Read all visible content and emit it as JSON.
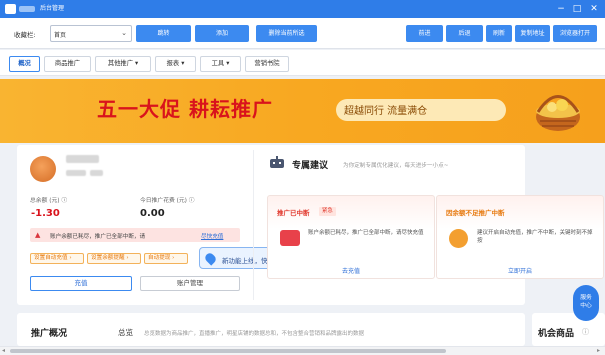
{
  "window": {
    "title": "后台管理",
    "controls": [
      "−",
      "□",
      "✕"
    ]
  },
  "toolbar": {
    "fav_label": "收藏栏:",
    "fav_value": "首页",
    "buttons": {
      "jump": "跳转",
      "add": "添加",
      "delete_selected": "删除当前所选",
      "back": "前进",
      "forward": "后退",
      "refresh": "刷新",
      "copy_url": "复制地址",
      "open_browser": "浏览器打开"
    }
  },
  "tabs": [
    {
      "label": "概况",
      "active": true
    },
    {
      "label": "商品推广"
    },
    {
      "label": "其他推广 ▾"
    },
    {
      "label": "报表 ▾"
    },
    {
      "label": "工具 ▾"
    },
    {
      "label": "营销书院"
    }
  ],
  "banner": {
    "headline": "五一大促 耕耘推广",
    "subline": "超越同行  流量满仓"
  },
  "account": {
    "balance_label": "总余额 (元) ⓘ",
    "balance_value": "-1.30",
    "spend_label": "今日推广花费 (元) ⓘ",
    "spend_value": "0.00",
    "warning_text": "账户余额已耗尽，推广已全部中断，请",
    "warning_link": "尽快充值",
    "pills": [
      "设置自动充值 ›",
      "设置余额提醒 ›",
      "自动提现 ›"
    ],
    "recharge_button": "充值",
    "manage_button": "账户管理"
  },
  "tooltip": {
    "text": "新功能上线，快来体验吧~",
    "close": "✕"
  },
  "suggestions": {
    "title": "专属建议",
    "desc": "为你定制专属优化建议，每天进步一小点~",
    "cards": [
      {
        "title": "推广已中断",
        "tag": "紧急",
        "desc": "账户余额已耗尽，推广已全部中断，请尽快充值",
        "link": "去充值"
      },
      {
        "title": "因余额不足推广中断",
        "desc": "建议开启自动充值，推广不中断，关键时刻不掉按",
        "link": "立即开启"
      }
    ]
  },
  "bottom": {
    "overview_title": "推广概况",
    "summary_label": "总览",
    "summary_desc": "总览数据为商品推广，直播推广，明星店铺的数据总和，不包含整合营销和品牌露出的数据",
    "right_title": "机会商品",
    "right_info": "ⓘ"
  },
  "fab": {
    "line1": "服务",
    "line2": "中心"
  },
  "colors": {
    "accent": "#2f7de8",
    "danger": "#d9131c",
    "banner": "#f7a521"
  }
}
